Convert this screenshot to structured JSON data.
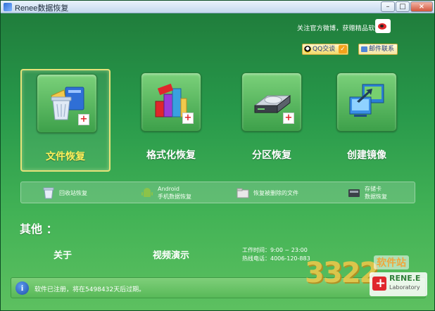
{
  "window": {
    "title": "Renee数据恢复",
    "controls": {
      "minimize": "–",
      "maximize": "□",
      "close": "×"
    }
  },
  "header": {
    "follow_text": "关注官方微博，获赠精品软件",
    "follow_icon": "weibo-icon",
    "qq_label": "QQ交谈",
    "contact_label": "邮件联系"
  },
  "features": [
    {
      "label": "文件恢复",
      "icon": "recycle-bin-icon",
      "selected": true
    },
    {
      "label": "格式化恢复",
      "icon": "format-recovery-icon",
      "selected": false
    },
    {
      "label": "分区恢复",
      "icon": "hard-drive-icon",
      "selected": false
    },
    {
      "label": "创建镜像",
      "icon": "image-backup-icon",
      "selected": false
    }
  ],
  "subfeatures": [
    {
      "line1": "回收站恢复",
      "icon": "recycle-bin-icon"
    },
    {
      "line1": "Android",
      "line2": "手机数据恢复",
      "icon": "android-icon"
    },
    {
      "line1": "恢复被删除的文件",
      "icon": "folder-icon"
    },
    {
      "line1": "存储卡",
      "line2": "数据恢复",
      "icon": "memory-card-icon"
    }
  ],
  "other": {
    "title": "其他 ：",
    "about": "关于",
    "video": "视频演示",
    "hours": "工作时间：9:00 ~ 23:00",
    "hotline": "热线电话：4006-120-883"
  },
  "status": {
    "message": "软件已注册，将在5498432天后过期。",
    "icon": "info-icon"
  },
  "watermark": {
    "number": "3322",
    "site": "软件站",
    "brand": "RENE.E",
    "brand_sub": "Laboratory"
  }
}
